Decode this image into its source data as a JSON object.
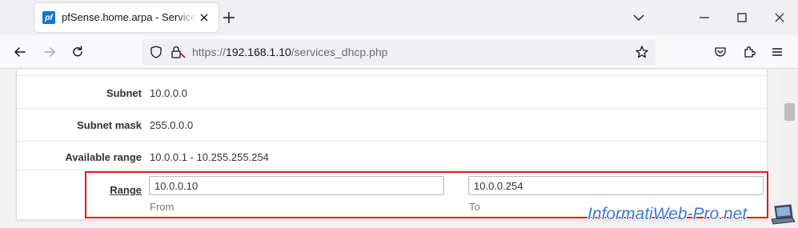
{
  "browser": {
    "tab": {
      "favicon_text": "pf",
      "title": "pfSense.home.arpa - Services: D"
    },
    "url": {
      "scheme": "https://",
      "host": "192.168.1.10",
      "path": "/services_dhcp.php"
    },
    "icons": {
      "back": "arrow-left-icon",
      "forward": "arrow-right-icon",
      "reload": "reload-icon",
      "shield": "shield-icon",
      "lock": "lock-icon",
      "bookmark": "star-icon",
      "pocket": "pocket-icon",
      "extensions": "puzzle-icon",
      "menu": "hamburger-menu-icon",
      "new_tab": "plus-icon",
      "tab_list": "chevron-down-icon",
      "minimize": "minimize-icon",
      "maximize": "maximize-icon",
      "close": "close-icon"
    }
  },
  "form": {
    "rows": [
      {
        "label": "Subnet",
        "value": "10.0.0.0"
      },
      {
        "label": "Subnet mask",
        "value": "255.0.0.0"
      },
      {
        "label": "Available range",
        "value": "10.0.0.1 - 10.255.255.254"
      }
    ],
    "range": {
      "label": "Range",
      "from_value": "10.0.0.10",
      "from_help": "From",
      "to_value": "10.0.0.254",
      "to_help": "To"
    }
  },
  "colors": {
    "highlight_border": "#e8141b",
    "watermark": "#3a7bd5",
    "favicon_bg": "#1475cf"
  },
  "watermark": {
    "text": "InformatiWeb-Pro.net"
  }
}
